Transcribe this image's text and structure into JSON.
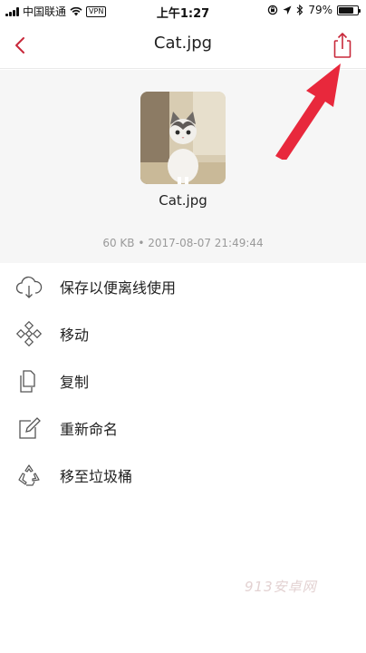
{
  "status_bar": {
    "carrier": "中国联通",
    "vpn": "VPN",
    "time": "上午1:27",
    "battery": "79%",
    "battery_level": 0.79
  },
  "nav": {
    "title": "Cat.jpg"
  },
  "file": {
    "name": "Cat.jpg",
    "meta": "60 KB • 2017-08-07 21:49:44"
  },
  "menu": {
    "items": [
      {
        "label": "保存以便离线使用",
        "icon": "cloud-download-icon"
      },
      {
        "label": "移动",
        "icon": "move-icon"
      },
      {
        "label": "复制",
        "icon": "copy-icon"
      },
      {
        "label": "重新命名",
        "icon": "rename-icon"
      },
      {
        "label": "移至垃圾桶",
        "icon": "recycle-icon"
      }
    ]
  },
  "watermark": "913安卓网",
  "colors": {
    "accent": "#c8283a",
    "preview_bg": "#f6f6f6",
    "arrow": "#e8283c"
  }
}
